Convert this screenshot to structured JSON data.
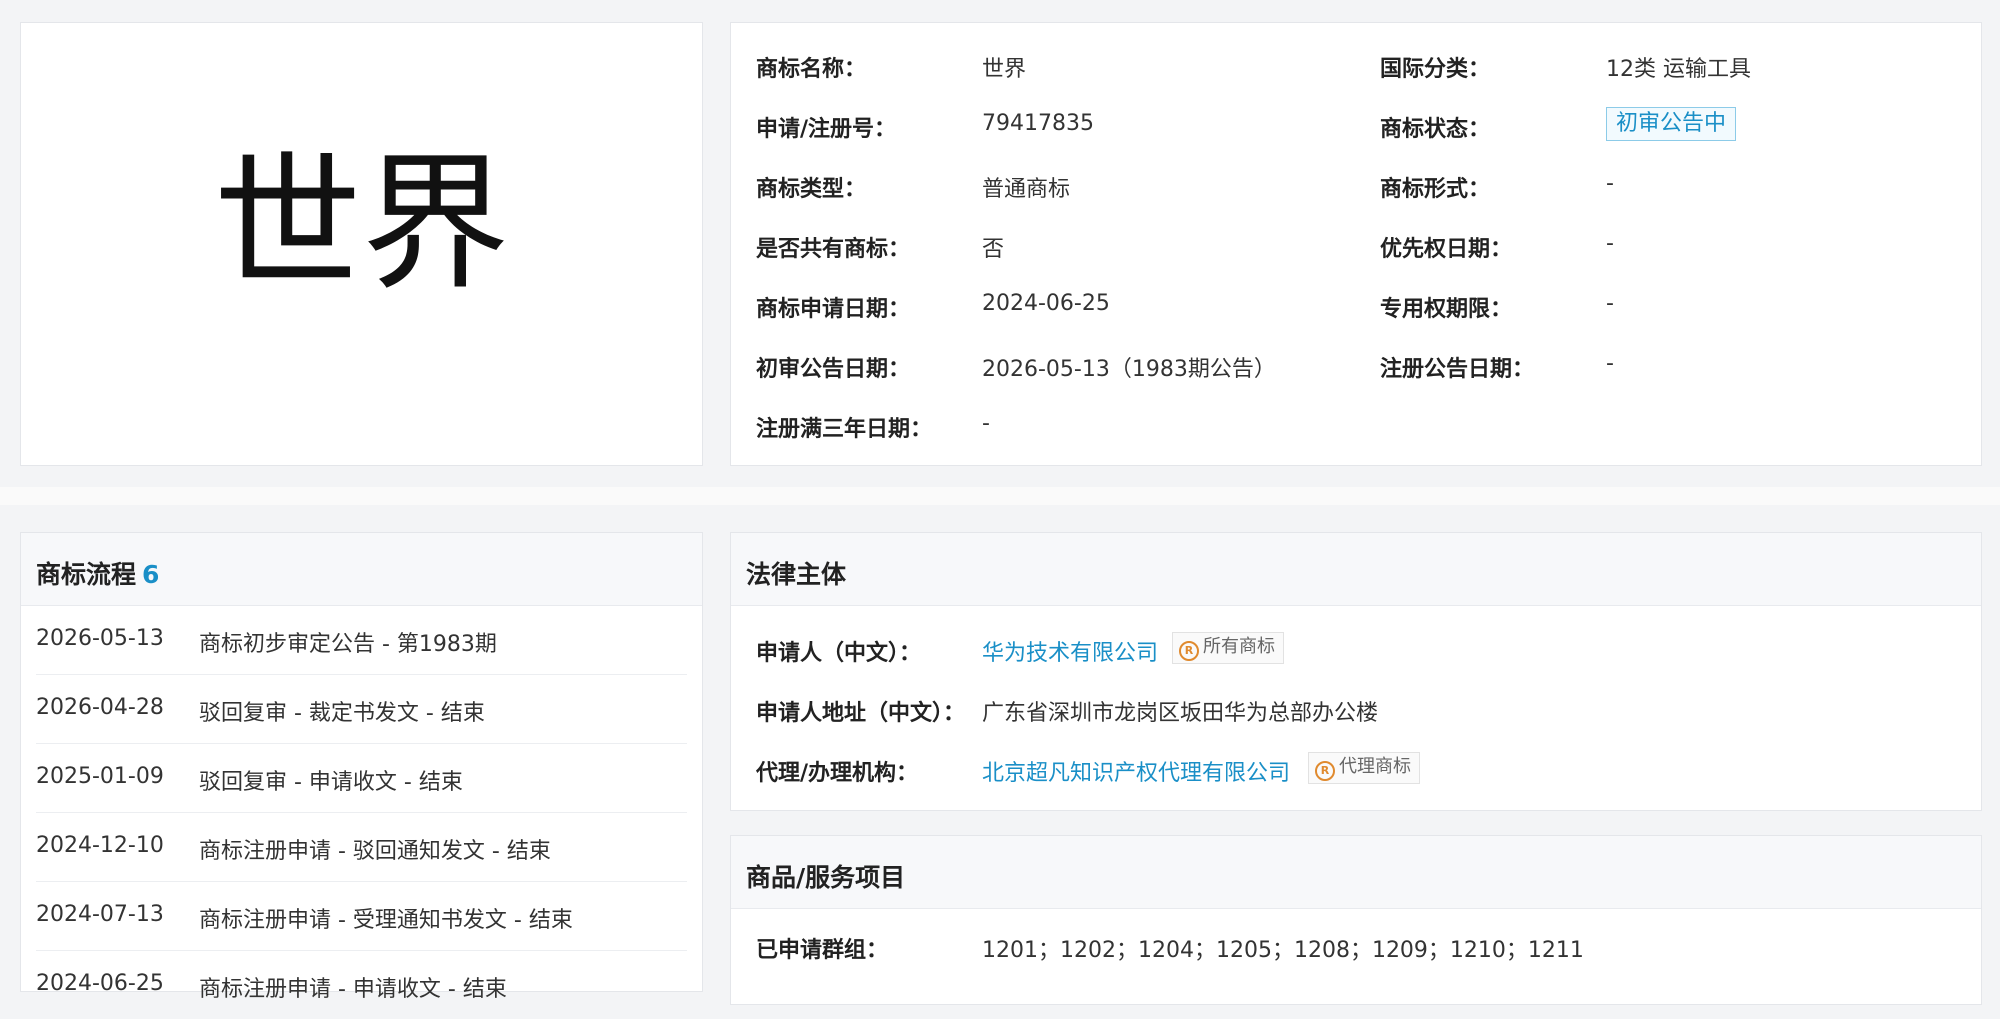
{
  "trademark": {
    "logo_text": "世界",
    "fields_left": [
      {
        "label": "商标名称：",
        "value": "世界"
      },
      {
        "label": "申请/注册号：",
        "value": "79417835"
      },
      {
        "label": "商标类型：",
        "value": "普通商标"
      },
      {
        "label": "是否共有商标：",
        "value": "否"
      },
      {
        "label": "商标申请日期：",
        "value": "2024-06-25"
      },
      {
        "label": "初审公告日期：",
        "value": "2026-05-13（1983期公告）"
      },
      {
        "label": "注册满三年日期：",
        "value": "-"
      }
    ],
    "fields_right": [
      {
        "label": "国际分类：",
        "value": "12类 运输工具"
      },
      {
        "label": "商标状态：",
        "value": "初审公告中"
      },
      {
        "label": "商标形式：",
        "value": "-"
      },
      {
        "label": "优先权日期：",
        "value": "-"
      },
      {
        "label": "专用权期限：",
        "value": "-"
      },
      {
        "label": "注册公告日期：",
        "value": "-"
      }
    ]
  },
  "flow": {
    "title": "商标流程",
    "count": "6",
    "items": [
      {
        "date": "2026-05-13",
        "desc": "商标初步审定公告 - 第1983期"
      },
      {
        "date": "2026-04-28",
        "desc": "驳回复审 - 裁定书发文 - 结束"
      },
      {
        "date": "2025-01-09",
        "desc": "驳回复审 - 申请收文 - 结束"
      },
      {
        "date": "2024-12-10",
        "desc": "商标注册申请 - 驳回通知发文 - 结束"
      },
      {
        "date": "2024-07-13",
        "desc": "商标注册申请 - 受理通知书发文 - 结束"
      },
      {
        "date": "2024-06-25",
        "desc": "商标注册申请 - 申请收文 - 结束"
      }
    ]
  },
  "legal": {
    "title": "法律主体",
    "applicant_label": "申请人（中文）：",
    "applicant_value": "华为技术有限公司",
    "applicant_tag": "所有商标",
    "address_label": "申请人地址（中文）：",
    "address_value": "广东省深圳市龙岗区坂田华为总部办公楼",
    "agent_label": "代理/办理机构：",
    "agent_value": "北京超凡知识产权代理有限公司",
    "agent_tag": "代理商标",
    "tag_icon": "registered-icon"
  },
  "goods": {
    "title": "商品/服务项目",
    "groups_label": "已申请群组：",
    "groups_value": "1201；1202；1204；1205；1208；1209；1210；1211"
  },
  "colors": {
    "accent": "#1a8fc7",
    "tag_icon": "#e08a2e",
    "background": "#f3f4f6"
  }
}
